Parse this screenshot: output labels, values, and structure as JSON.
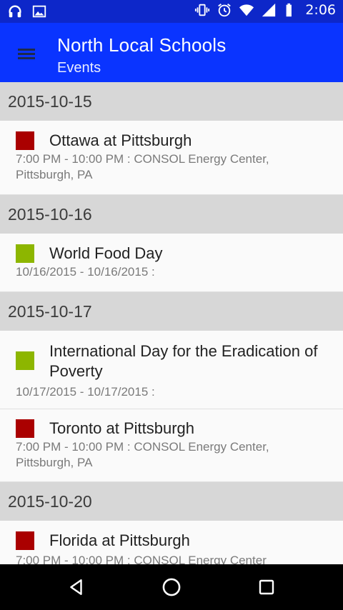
{
  "status_bar": {
    "time": "2:06",
    "left_icons": [
      "headphones-icon",
      "image-icon"
    ],
    "right_icons": [
      "vibrate-icon",
      "alarm-icon",
      "wifi-icon",
      "signal-icon",
      "battery-icon"
    ]
  },
  "app_bar": {
    "title": "North Local Schools",
    "subtitle": "Events",
    "menu_icon": "hamburger-menu-icon",
    "background_color": "#0a34ff"
  },
  "colors": {
    "red": "#aa0000",
    "green": "#8db600"
  },
  "groups": [
    {
      "date": "2015-10-15",
      "events": [
        {
          "color": "#aa0000",
          "title": "Ottawa at Pittsburgh",
          "detail": "7:00 PM - 10:00 PM : CONSOL Energy Center, Pittsburgh, PA"
        }
      ]
    },
    {
      "date": "2015-10-16",
      "events": [
        {
          "color": "#8db600",
          "title": "World Food Day",
          "detail": "10/16/2015 - 10/16/2015 :"
        }
      ]
    },
    {
      "date": "2015-10-17",
      "events": [
        {
          "color": "#8db600",
          "title": "International Day for the Eradication of Poverty",
          "detail": "10/17/2015 - 10/17/2015 :"
        },
        {
          "color": "#aa0000",
          "title": "Toronto at Pittsburgh",
          "detail": "7:00 PM - 10:00 PM : CONSOL Energy Center, Pittsburgh, PA"
        }
      ]
    },
    {
      "date": "2015-10-20",
      "events": [
        {
          "color": "#aa0000",
          "title": "Florida at Pittsburgh",
          "detail": "7:00 PM - 10:00 PM : CONSOL Energy Center"
        }
      ]
    }
  ],
  "nav_bar": {
    "buttons": [
      "back-icon",
      "home-icon",
      "recents-icon"
    ]
  }
}
